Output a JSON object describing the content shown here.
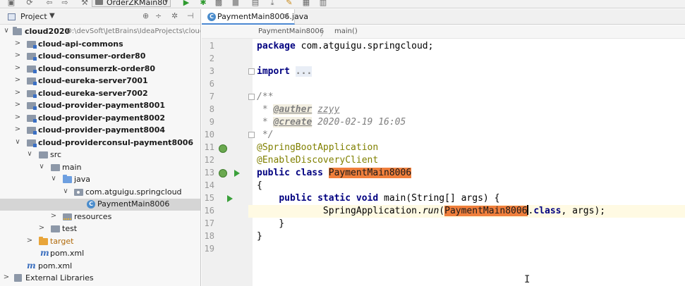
{
  "toolbar": {
    "run_config_label": "OrderZKMain80"
  },
  "project_panel": {
    "title": "Project",
    "dropdown": "▼",
    "tree": [
      {
        "label": "cloud2020",
        "path": "D:\\devSoft\\JetBrains\\IdeaProjects\\cloud",
        "arrow": "∨",
        "icon": "folder"
      },
      {
        "label": "cloud-api-commons",
        "arrow": ">",
        "icon": "module"
      },
      {
        "label": "cloud-consumer-order80",
        "arrow": ">",
        "icon": "module"
      },
      {
        "label": "cloud-consumerzk-order80",
        "arrow": ">",
        "icon": "module"
      },
      {
        "label": "cloud-eureka-server7001",
        "arrow": ">",
        "icon": "module"
      },
      {
        "label": "cloud-eureka-server7002",
        "arrow": ">",
        "icon": "module"
      },
      {
        "label": "cloud-provider-payment8001",
        "arrow": ">",
        "icon": "module"
      },
      {
        "label": "cloud-provider-payment8002",
        "arrow": ">",
        "icon": "module"
      },
      {
        "label": "cloud-provider-payment8004",
        "arrow": ">",
        "icon": "module"
      },
      {
        "label": "cloud-providerconsul-payment8006",
        "arrow": "∨",
        "icon": "module"
      },
      {
        "label": "src",
        "arrow": "∨",
        "icon": "src"
      },
      {
        "label": "main",
        "arrow": "∨",
        "icon": "src"
      },
      {
        "label": "java",
        "arrow": "∨",
        "icon": "java-src"
      },
      {
        "label": "com.atguigu.springcloud",
        "arrow": "∨",
        "icon": "pkg"
      },
      {
        "label": "PaymentMain8006",
        "arrow": "",
        "icon": "class"
      },
      {
        "label": "resources",
        "arrow": ">",
        "icon": "res"
      },
      {
        "label": "test",
        "arrow": ">",
        "icon": "src"
      },
      {
        "label": "target",
        "arrow": ">",
        "icon": "target"
      },
      {
        "label": "pom.xml",
        "arrow": "",
        "icon": "maven"
      },
      {
        "label": "pom.xml",
        "arrow": "",
        "icon": "maven"
      },
      {
        "label": "External Libraries",
        "arrow": ">",
        "icon": "libs"
      }
    ]
  },
  "editor": {
    "tab_label": "PaymentMain8006.java",
    "tab_close": "×",
    "breadcrumb": [
      "PaymentMain8006",
      "main()"
    ],
    "line_numbers": [
      "1",
      "2",
      "3",
      "6",
      "7",
      "8",
      "9",
      "10",
      "11",
      "12",
      "13",
      "14",
      "15",
      "16",
      "17",
      "18",
      "19"
    ],
    "code": {
      "l1_kw": "package",
      "l1_rest": " com.atguigu.springcloud;",
      "l3_kw": "import",
      "l3_fold": "...",
      "l7": "/**",
      "l8_star": " * ",
      "l8_tag": "@auther",
      "l8_val": "zzyy",
      "l9_star": " * ",
      "l9_tag": "@create",
      "l9_val": " 2020-02-19 16:05",
      "l10": " */",
      "l11": "@SpringBootApplication",
      "l12": "@EnableDiscoveryClient",
      "l13_kw": "public class",
      "l13_name": "PaymentMain8006",
      "l14": "{",
      "l15_indent": "    ",
      "l15_kw": "public static void",
      "l15_rest": " main(String[] args) {",
      "l16_indent": "            SpringApplication.",
      "l16_method": "run",
      "l16_paren": "(",
      "l16_name": "PaymentMain8006",
      "l16_dot": ".",
      "l16_kw": "class",
      "l16_rest": ", args);",
      "l17": "    }",
      "l18": "}"
    }
  }
}
